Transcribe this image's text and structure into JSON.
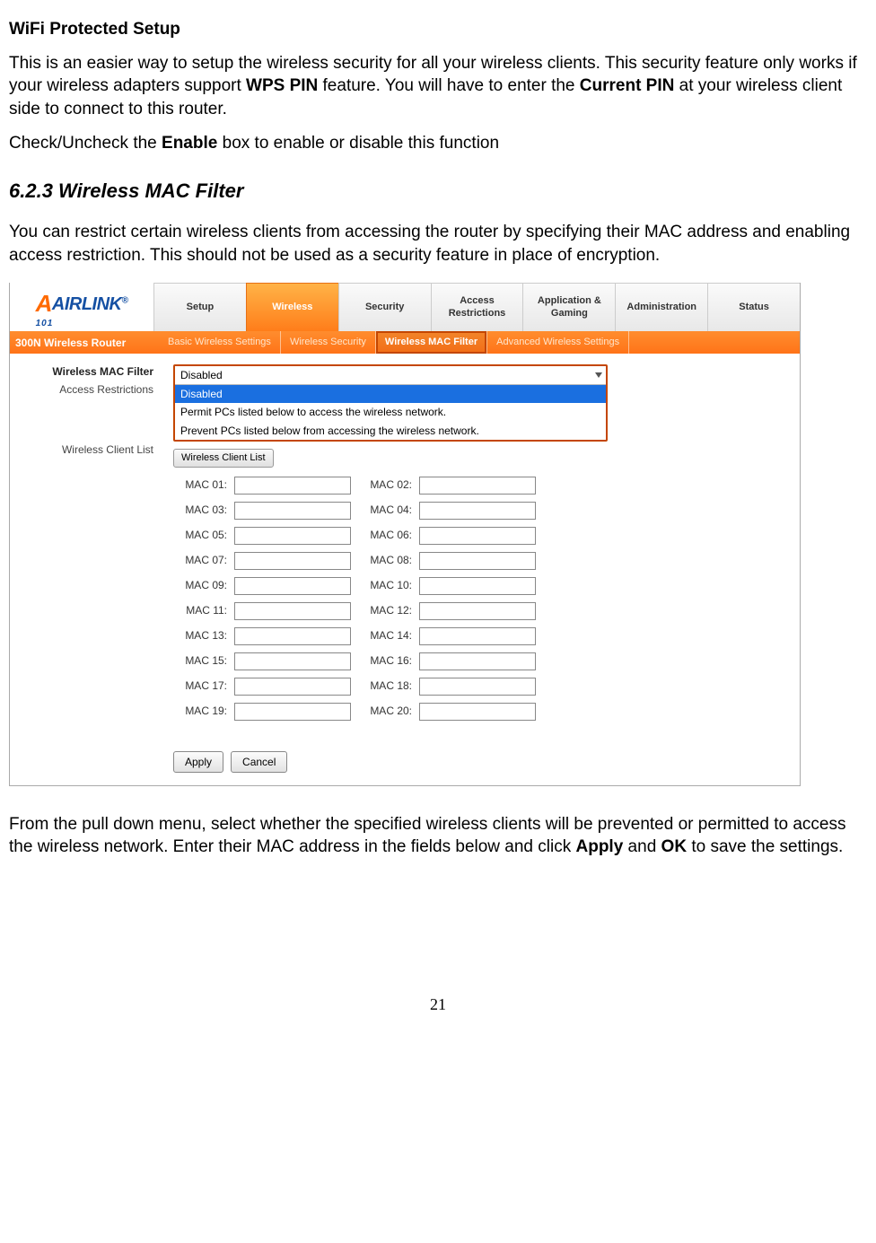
{
  "doc": {
    "h1": "WiFi Protected Setup",
    "p1_a": "This is an easier way to setup the wireless security for all your wireless clients. This security feature only works if your wireless adapters support ",
    "p1_b": "WPS PIN",
    "p1_c": " feature. You will have to enter the ",
    "p1_d": "Current PIN",
    "p1_e": " at your wireless client side to connect to this router.",
    "p2_a": "Check/Uncheck the ",
    "p2_b": "Enable",
    "p2_c": " box to enable or disable this function",
    "h2": "6.2.3 Wireless MAC Filter",
    "p3": "You can restrict certain wireless clients from accessing the router by specifying their MAC address and enabling access restriction.  This should not be used as a security feature in place of encryption.",
    "p4_a": "From the pull down menu, select whether the specified wireless clients will be prevented or permitted to access the wireless network. Enter their MAC address in the fields below and click ",
    "p4_b": "Apply",
    "p4_c": " and ",
    "p4_d": "OK",
    "p4_e": " to save the settings.",
    "page_num": "21"
  },
  "fig": {
    "logo_brand": "AIRLINK",
    "logo_num": "101",
    "logo_reg": "®",
    "router_model": "300N Wireless Router",
    "tabs": [
      "Setup",
      "Wireless",
      "Security",
      "Access Restrictions",
      "Application & Gaming",
      "Administration",
      "Status"
    ],
    "active_tab_index": 1,
    "subtabs": [
      "Basic Wireless Settings",
      "Wireless Security",
      "Wireless MAC Filter",
      "Advanced Wireless Settings"
    ],
    "active_subtab_index": 2,
    "sidebar": {
      "title": "Wireless MAC Filter",
      "label1": "Access Restrictions",
      "label2": "Wireless Client List"
    },
    "dropdown": {
      "selected": "Disabled",
      "opt_hl": "Disabled",
      "opt2": "Permit PCs listed below to access the wireless network.",
      "opt3": "Prevent PCs listed below from accessing the wireless network."
    },
    "client_btn": "Wireless Client List",
    "mac_labels": [
      "MAC 01:",
      "MAC 02:",
      "MAC 03:",
      "MAC 04:",
      "MAC 05:",
      "MAC 06:",
      "MAC 07:",
      "MAC 08:",
      "MAC 09:",
      "MAC 10:",
      "MAC 11:",
      "MAC 12:",
      "MAC 13:",
      "MAC 14:",
      "MAC 15:",
      "MAC 16:",
      "MAC 17:",
      "MAC 18:",
      "MAC 19:",
      "MAC 20:"
    ],
    "apply": "Apply",
    "cancel": "Cancel"
  }
}
